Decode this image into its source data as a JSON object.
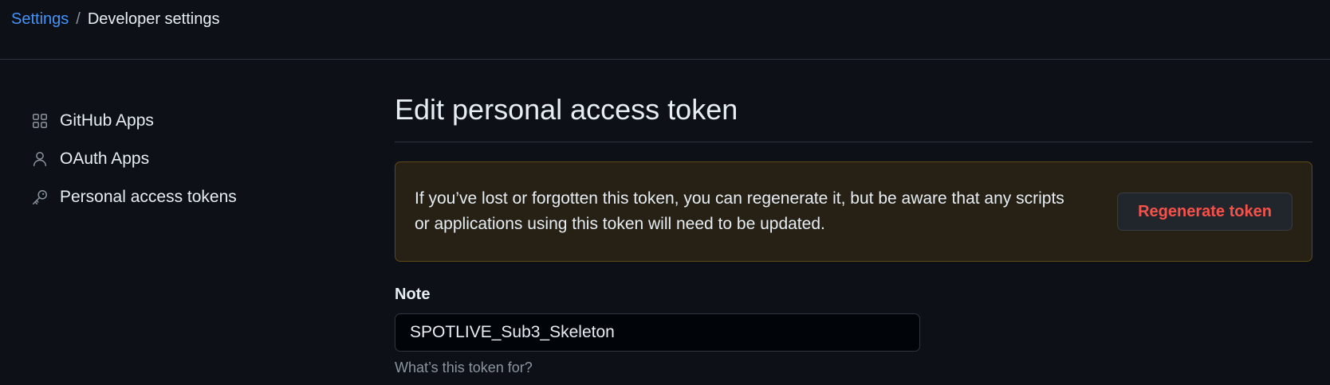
{
  "breadcrumb": {
    "root": "Settings",
    "separator": "/",
    "current": "Developer settings"
  },
  "sidebar": {
    "items": [
      {
        "label": "GitHub Apps",
        "icon": "apps-icon"
      },
      {
        "label": "OAuth Apps",
        "icon": "person-icon"
      },
      {
        "label": "Personal access tokens",
        "icon": "key-icon"
      }
    ]
  },
  "main": {
    "title": "Edit personal access token",
    "flash": {
      "text": "If you’ve lost or forgotten this token, you can regenerate it, but be aware that any scripts or applications using this token will need to be updated.",
      "button_label": "Regenerate token"
    },
    "note": {
      "label": "Note",
      "value": "SPOTLIVE_Sub3_Skeleton",
      "hint": "What’s this token for?"
    }
  },
  "colors": {
    "background": "#0d1117",
    "link": "#4493f8",
    "danger": "#f85149",
    "warning_bg": "#272115",
    "warning_border": "#5c4a17"
  }
}
